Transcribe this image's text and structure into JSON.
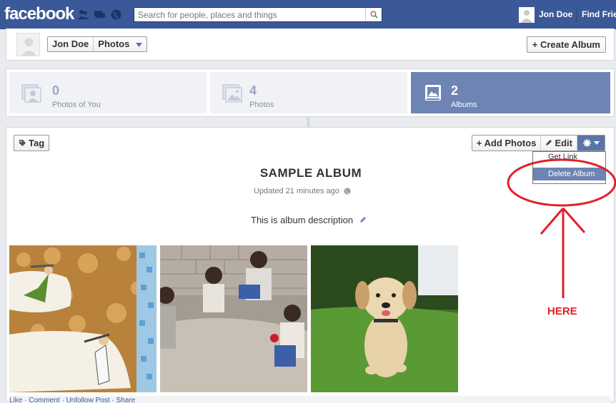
{
  "topbar": {
    "logo": "facebook",
    "search_placeholder": "Search for people, places and things",
    "user_name": "Jon Doe",
    "find_friends": "Find Frie",
    "brand_color": "#3b5998"
  },
  "header": {
    "breadcrumbs": [
      "Jon Doe",
      "Photos"
    ],
    "create_album": "+ Create Album"
  },
  "stats": [
    {
      "count": "0",
      "label": "Photos of You",
      "active": false
    },
    {
      "count": "4",
      "label": "Photos",
      "active": false
    },
    {
      "count": "2",
      "label": "Albums",
      "active": true
    }
  ],
  "album": {
    "tag_label": "Tag",
    "add_photos": "+ Add Photos",
    "edit": "Edit",
    "title": "SAMPLE ALBUM",
    "updated": "Updated 21 minutes ago",
    "description": "This is album description",
    "menu": [
      "Get Link",
      "Delete Album"
    ],
    "photos": [
      "miners-digging-cartoon",
      "children-sitting-on-ground",
      "puppy-running-on-grass"
    ]
  },
  "bottom_links": "Like · Comment · Unfollow Post · Share",
  "annotation": {
    "label": "HERE",
    "color": "#e0202a"
  }
}
